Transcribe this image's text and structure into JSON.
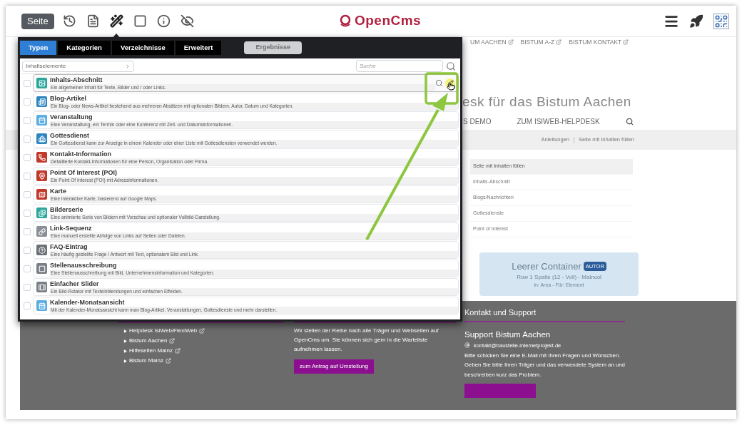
{
  "toolbar": {
    "page_button": "Seite",
    "tools": [
      {
        "selected": false
      },
      {
        "selected": false
      },
      {
        "selected": true
      },
      {
        "selected": false
      },
      {
        "selected": false
      },
      {
        "selected": false
      }
    ],
    "logo": "OpenCms"
  },
  "gallery": {
    "tabs": [
      {
        "label": "Typen",
        "selected": true
      },
      {
        "label": "Kategorien",
        "selected": false
      },
      {
        "label": "Verzeichnisse",
        "selected": false
      },
      {
        "label": "Erweitert",
        "selected": false
      }
    ],
    "results_button": {
      "label": "Ergebnisse",
      "disabled": true
    },
    "filter": {
      "value": "Inhaltselemente"
    },
    "search": {
      "placeholder": "Suche"
    },
    "items": [
      {
        "title": "Inhalts-Abschnitt",
        "description": "Ein allgemeiner Inhalt für Texte, Bilder und / oder Links.",
        "checked": false,
        "hovered": true,
        "color": "#2aa69a"
      },
      {
        "title": "Blog-Artikel",
        "description": "Ein Blog- oder News-Artikel bestehend aus mehreren Absätzen mit optionalen Bildern, Autor, Datum und Kategorien.",
        "checked": false,
        "hovered": false,
        "color": "#2e86c1"
      },
      {
        "title": "Veranstaltung",
        "description": "Eine Veranstaltung, ein Termin oder eine Konferenz mit Zeit- und Datumsinformationen.",
        "checked": false,
        "hovered": false,
        "color": "#5dade2"
      },
      {
        "title": "Gottesdienst",
        "description": "Ein Gottesdienst kann zur Anzeige in einem Kalender oder einer Liste mit Gottesdiensten verwendet werden.",
        "checked": false,
        "hovered": false,
        "color": "#2e86c1"
      },
      {
        "title": "Kontakt-Information",
        "description": "Detaillierte Kontakt-Informationen für eine Person, Organisation oder Firma.",
        "checked": false,
        "hovered": false,
        "color": "#c0392b"
      },
      {
        "title": "Point Of Interest (POI)",
        "description": "Ein Point Of Interest (POI) mit Adressinformationen.",
        "checked": false,
        "hovered": false,
        "color": "#c0392b"
      },
      {
        "title": "Karte",
        "description": "Eine interaktive Karte, basierend auf Google Maps.",
        "checked": false,
        "hovered": false,
        "color": "#c0392b"
      },
      {
        "title": "Bilderserie",
        "description": "Eine animierte Serie von Bildern mit Vorschau und optionaler Vollbild-Darstellung.",
        "checked": false,
        "hovered": false,
        "color": "#2aa69a"
      },
      {
        "title": "Link-Sequenz",
        "description": "Eine manuell erstellte Abfolge von Links auf Seiten oder Dateien.",
        "checked": false,
        "hovered": false,
        "color": "#8a8f96"
      },
      {
        "title": "FAQ-Eintrag",
        "description": "Eine häufig gestellte Frage / Antwort mit Text, optionalem Bild und Link.",
        "checked": false,
        "hovered": false,
        "color": "#6c7077"
      },
      {
        "title": "Stellenausschreibung",
        "description": "Eine Stellenausschreibung mit Bild, Unternehmensinformation und Kategorien.",
        "checked": false,
        "hovered": false,
        "color": "#7b8087"
      },
      {
        "title": "Einfacher Slider",
        "description": "Ein Bild-Rotator mit Texteinblendungen und einfachen Effekten.",
        "checked": false,
        "hovered": false,
        "color": "#7b8087"
      },
      {
        "title": "Kalender-Monatsansicht",
        "description": "Mit der Kalender-Monatsansicht kann man Blog-Artikel, Veranstaltungen, Gottesdienste und mehr darstellen.",
        "checked": false,
        "hovered": false,
        "color": "#5dade2"
      }
    ]
  },
  "site": {
    "top_links": [
      "UM AACHEN",
      "BISTUM A-Z",
      "BISTUM KONTAKT"
    ],
    "title": "esk für das Bistum Aachen",
    "nav": [
      "S DEMO",
      "ZUM ISIWEB-HELPDESK"
    ],
    "breadcrumb": [
      "Anleitungen",
      "Seite mit Inhalten füllen"
    ],
    "sidebar": [
      {
        "label": "Seite mit Inhalten füllen",
        "selected": true
      },
      {
        "label": "Inhalts-Abschnitt",
        "selected": false
      },
      {
        "label": "Blogs/Nachrichten",
        "selected": false
      },
      {
        "label": "Gottesdienste",
        "selected": false
      },
      {
        "label": "Point of Interest",
        "selected": false
      }
    ],
    "container": {
      "title": "Leerer Container",
      "badge": "AUTOR",
      "line_1": "Row 1 Spalte (12 - Voll) - Maincol",
      "line_2": "in: Area - Für: Element"
    },
    "footer": {
      "links": [
        "Helpdesk IsiWeb/FlexiWeb",
        "Bistum Aachen",
        "Hilfeseiten Mainz",
        "Bistum Mainz"
      ],
      "text": "Wir stellen der Reihe nach alle Träger und Webseiten auf OpenCms um. Sie können sich gern in die Warteliste aufnehmen lassen.",
      "button": "zum Antrag auf Umstellung",
      "contact_heading": "Kontakt und Support",
      "support_title": "Support Bistum Aachen",
      "email": "kontakt@baustelle-internetprojekt.de",
      "support_text": "Bitte schicken Sie eine E-Mail mit Ihren Fragen und Wünschen. Geben Sie bitte Ihren Träger und das verwendete System an und beschreiben kurz das Problem."
    }
  }
}
